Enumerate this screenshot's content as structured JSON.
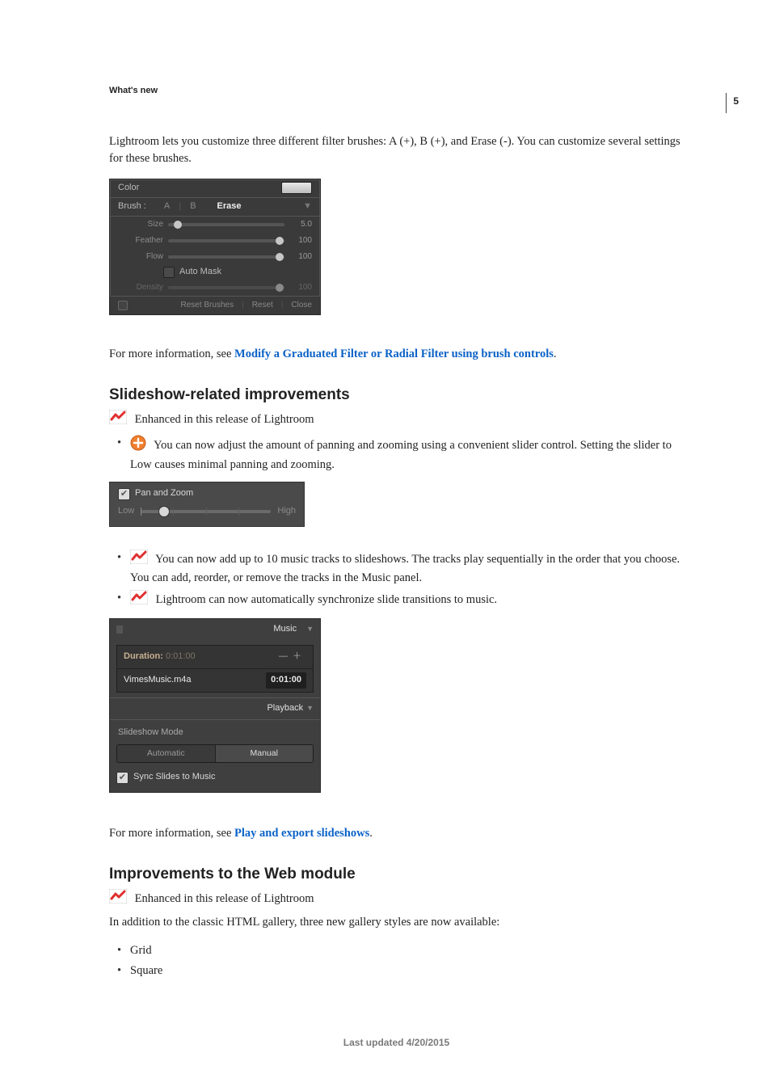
{
  "page_number": "5",
  "section_label": "What's new",
  "intro": "Lightroom lets you customize three different filter brushes: A (+), B (+), and Erase (-). You can customize several settings for these brushes.",
  "brush_panel": {
    "color_label": "Color",
    "brush_label": "Brush :",
    "tab_a": "A",
    "tab_b": "B",
    "tab_erase": "Erase",
    "disclosure": "▼",
    "sliders": [
      {
        "label": "Size",
        "value": "5.0",
        "pos": 8
      },
      {
        "label": "Feather",
        "value": "100",
        "pos": 96
      },
      {
        "label": "Flow",
        "value": "100",
        "pos": 96
      }
    ],
    "automask_label": "Auto Mask",
    "density": {
      "label": "Density",
      "value": "100",
      "pos": 96
    },
    "footer": {
      "reset_brushes": "Reset Brushes",
      "reset": "Reset",
      "close": "Close"
    }
  },
  "more_info_1_prefix": "For more information, see ",
  "more_info_1_link": "Modify a Graduated Filter or Radial Filter using brush controls",
  "h_slideshow": "Slideshow-related improvements",
  "enhanced_text": "Enhanced in this release of Lightroom",
  "sl_bullets_1": "You can now adjust the amount of panning and zooming using a convenient slider control. Setting the slider to Low causes minimal panning and zooming.",
  "pz": {
    "label": "Pan and Zoom",
    "low": "Low",
    "high": "High"
  },
  "sl_bullets_2": "You can now add up to 10 music tracks to slideshows. The tracks play sequentially in the order that you choose. You can add, reorder, or remove the tracks in the Music panel.",
  "sl_bullets_3": "Lightroom can now automatically synchronize slide transitions to music.",
  "music_panel": {
    "title": "Music",
    "duration_label": "Duration:",
    "duration_value": "0:01:00",
    "add_icon": "＋",
    "remove_icon": "—",
    "track_name": "VimesMusic.m4a",
    "track_duration": "0:01:00",
    "playback_title": "Playback",
    "mode_label": "Slideshow Mode",
    "opt_auto": "Automatic",
    "opt_manual": "Manual",
    "sync_label": "Sync Slides to Music"
  },
  "more_info_2_prefix": "For more information, see ",
  "more_info_2_link": "Play and export slideshows",
  "h_web": "Improvements to the Web module",
  "web_intro": "In addition to the classic HTML gallery, three new gallery styles are now available:",
  "web_items": [
    "Grid",
    "Square"
  ],
  "footer": "Last updated 4/20/2015"
}
